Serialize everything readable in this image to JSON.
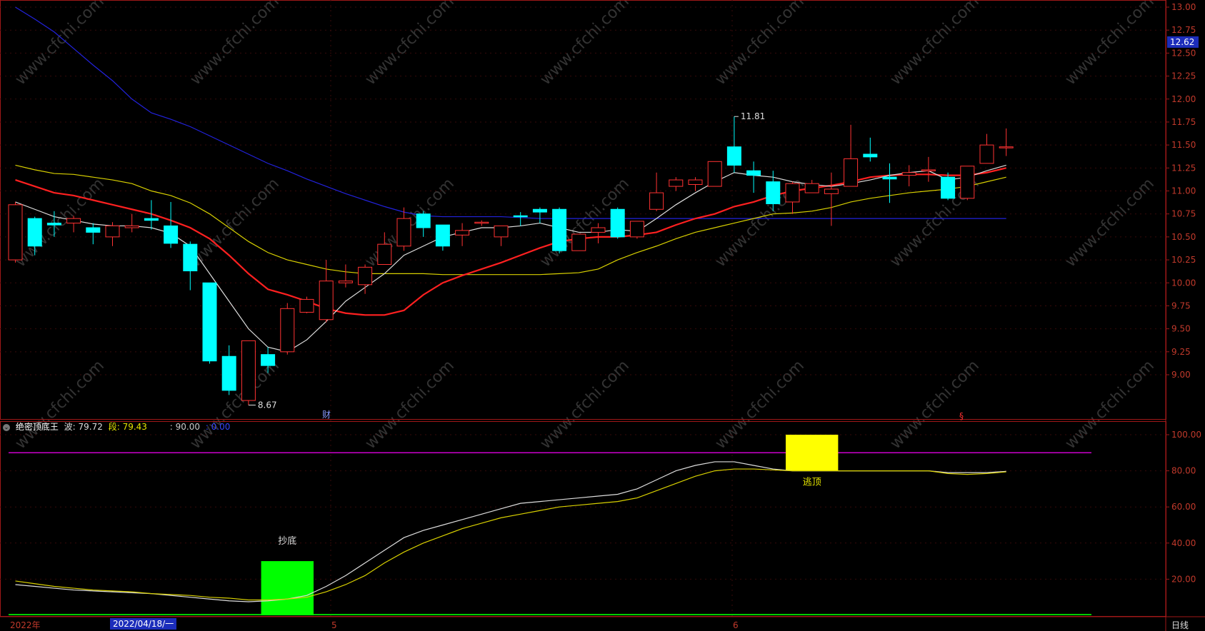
{
  "chart_data": [
    {
      "type": "candlestick",
      "ylim": [
        8.5,
        13.0
      ],
      "y_ticks": [
        "13.00",
        "12.75",
        "12.50",
        "12.25",
        "12.00",
        "11.75",
        "11.50",
        "11.25",
        "11.00",
        "10.75",
        "10.50",
        "10.25",
        "10.00",
        "9.75",
        "9.50",
        "9.25",
        "9.00"
      ],
      "current_price": "12.62",
      "annotations": {
        "high": "11.81",
        "low": "8.67",
        "cai_marker": "财",
        "s_marker": "§"
      },
      "candles": [
        [
          10.25,
          10.85,
          10.22,
          10.88
        ],
        [
          10.7,
          10.4,
          10.3,
          10.72
        ],
        [
          10.65,
          10.63,
          10.5,
          10.78
        ],
        [
          10.65,
          10.7,
          10.55,
          10.73
        ],
        [
          10.6,
          10.55,
          10.42,
          10.65
        ],
        [
          10.5,
          10.62,
          10.4,
          10.66
        ],
        [
          10.6,
          10.62,
          10.55,
          10.75
        ],
        [
          10.7,
          10.68,
          10.58,
          10.9
        ],
        [
          10.62,
          10.43,
          10.38,
          10.88
        ],
        [
          10.42,
          10.13,
          9.92,
          10.45
        ],
        [
          10.0,
          9.15,
          9.12,
          10.0
        ],
        [
          9.2,
          8.83,
          8.78,
          9.32
        ],
        [
          8.72,
          9.37,
          8.67,
          9.37
        ],
        [
          9.22,
          9.1,
          9.02,
          9.3
        ],
        [
          9.25,
          9.72,
          9.22,
          9.78
        ],
        [
          9.68,
          9.82,
          9.67,
          9.85
        ],
        [
          9.6,
          10.02,
          9.57,
          10.25
        ],
        [
          10.0,
          10.02,
          9.95,
          10.2
        ],
        [
          9.98,
          10.17,
          9.88,
          10.2
        ],
        [
          10.2,
          10.42,
          10.2,
          10.55
        ],
        [
          10.4,
          10.7,
          10.35,
          10.82
        ],
        [
          10.75,
          10.6,
          10.5,
          10.78
        ],
        [
          10.63,
          10.4,
          10.35,
          10.63
        ],
        [
          10.52,
          10.57,
          10.4,
          10.65
        ],
        [
          10.65,
          10.66,
          10.62,
          10.68
        ],
        [
          10.5,
          10.62,
          10.4,
          10.62
        ],
        [
          10.73,
          10.72,
          10.62,
          10.77
        ],
        [
          10.8,
          10.77,
          10.65,
          10.82
        ],
        [
          10.8,
          10.35,
          10.32,
          10.82
        ],
        [
          10.35,
          10.53,
          10.35,
          10.53
        ],
        [
          10.55,
          10.6,
          10.43,
          10.65
        ],
        [
          10.8,
          10.5,
          10.48,
          10.82
        ],
        [
          10.5,
          10.67,
          10.48,
          10.67
        ],
        [
          10.8,
          10.98,
          10.78,
          11.2
        ],
        [
          11.05,
          11.12,
          11.0,
          11.15
        ],
        [
          11.07,
          11.12,
          11.0,
          11.15
        ],
        [
          11.05,
          11.32,
          11.05,
          11.32
        ],
        [
          11.48,
          11.28,
          11.2,
          11.81
        ],
        [
          11.22,
          11.17,
          10.98,
          11.32
        ],
        [
          11.1,
          10.86,
          10.78,
          11.22
        ],
        [
          10.88,
          11.08,
          10.75,
          11.1
        ],
        [
          10.98,
          11.08,
          10.98,
          11.12
        ],
        [
          10.97,
          11.02,
          10.62,
          11.2
        ],
        [
          11.05,
          11.35,
          11.05,
          11.72
        ],
        [
          11.4,
          11.37,
          11.32,
          11.58
        ],
        [
          11.15,
          11.13,
          10.87,
          11.3
        ],
        [
          11.17,
          11.2,
          11.05,
          11.28
        ],
        [
          11.22,
          11.23,
          11.1,
          11.37
        ],
        [
          11.15,
          10.92,
          10.9,
          11.2
        ],
        [
          10.92,
          11.27,
          10.9,
          11.27
        ],
        [
          11.3,
          11.5,
          11.3,
          11.62
        ],
        [
          11.48,
          11.48,
          11.38,
          11.68
        ]
      ],
      "ma_white": [
        10.88,
        10.8,
        10.72,
        10.68,
        10.64,
        10.62,
        10.62,
        10.6,
        10.54,
        10.4,
        10.1,
        9.8,
        9.5,
        9.3,
        9.25,
        9.38,
        9.58,
        9.8,
        9.95,
        10.1,
        10.3,
        10.4,
        10.5,
        10.55,
        10.6,
        10.6,
        10.62,
        10.65,
        10.6,
        10.55,
        10.55,
        10.58,
        10.56,
        10.7,
        10.85,
        10.98,
        11.1,
        11.2,
        11.17,
        11.15,
        11.1,
        11.07,
        11.05,
        11.08,
        11.12,
        11.17,
        11.2,
        11.22,
        11.12,
        11.15,
        11.22,
        11.28
      ],
      "ma_red": [
        11.12,
        11.05,
        10.98,
        10.95,
        10.9,
        10.85,
        10.8,
        10.75,
        10.68,
        10.6,
        10.48,
        10.3,
        10.1,
        9.93,
        9.87,
        9.8,
        9.72,
        9.67,
        9.65,
        9.65,
        9.7,
        9.87,
        10.0,
        10.08,
        10.15,
        10.22,
        10.3,
        10.38,
        10.45,
        10.48,
        10.5,
        10.5,
        10.52,
        10.55,
        10.63,
        10.7,
        10.75,
        10.83,
        10.88,
        10.95,
        11.0,
        11.03,
        11.06,
        11.1,
        11.15,
        11.17,
        11.18,
        11.18,
        11.17,
        11.17,
        11.2,
        11.25
      ],
      "ma_yellow": [
        11.28,
        11.23,
        11.19,
        11.18,
        11.15,
        11.12,
        11.08,
        11.0,
        10.95,
        10.87,
        10.75,
        10.6,
        10.45,
        10.33,
        10.25,
        10.2,
        10.15,
        10.12,
        10.1,
        10.1,
        10.1,
        10.1,
        10.09,
        10.09,
        10.09,
        10.09,
        10.09,
        10.09,
        10.1,
        10.11,
        10.15,
        10.25,
        10.33,
        10.4,
        10.48,
        10.55,
        10.6,
        10.65,
        10.7,
        10.75,
        10.76,
        10.78,
        10.82,
        10.88,
        10.92,
        10.95,
        10.98,
        11.0,
        11.02,
        11.05,
        11.1,
        11.15
      ],
      "ma_blue": [
        13.0,
        12.87,
        12.73,
        12.55,
        12.37,
        12.2,
        12.0,
        11.85,
        11.78,
        11.7,
        11.6,
        11.5,
        11.4,
        11.3,
        11.22,
        11.13,
        11.05,
        10.97,
        10.9,
        10.83,
        10.77,
        10.73,
        10.72,
        10.72,
        10.72,
        10.72,
        10.71,
        10.7,
        10.7,
        10.7,
        10.7,
        10.7,
        10.7,
        10.7,
        10.7,
        10.7,
        10.7,
        10.7,
        10.7,
        10.7,
        10.7,
        10.7,
        10.7,
        10.7,
        10.7,
        10.7,
        10.7,
        10.7,
        10.7,
        10.7,
        10.7,
        10.7
      ]
    },
    {
      "type": "line",
      "title": "绝密顶底王",
      "legend": {
        "wave_label": "波: 79.72",
        "segment_label": "段: 79.43",
        "level_label": ": 90.00",
        "zero_label": ": 0.00"
      },
      "ylim": [
        0,
        105
      ],
      "y_ticks": [
        "100.00",
        "80.00",
        "60.00",
        "40.00",
        "20.00"
      ],
      "threshold_high": 90,
      "threshold_low": 0,
      "signals": [
        {
          "label": "抄底",
          "type": "buy",
          "bar_start": 13,
          "bar_end": 15,
          "y_from": 0,
          "y_to": 30,
          "color": "#00ff00"
        },
        {
          "label": "逃顶",
          "type": "sell",
          "bar_start": 40,
          "bar_end": 42,
          "y_from": 80,
          "y_to": 100,
          "color": "#ffff00"
        }
      ],
      "series": [
        {
          "values": [
            17,
            16,
            15,
            14,
            13.5,
            13,
            12.5,
            12,
            11,
            10,
            9,
            8,
            7.5,
            8,
            9,
            11,
            16,
            22,
            29,
            36,
            43,
            47,
            50,
            53,
            56,
            59,
            62,
            63,
            64,
            65,
            66,
            67,
            70,
            75,
            80,
            83,
            85,
            85,
            83,
            81,
            80,
            80,
            80,
            80,
            80,
            80,
            80,
            80,
            79,
            79,
            79,
            79.72
          ]
        },
        {
          "values": [
            19,
            17.5,
            16,
            15,
            14,
            13.5,
            13,
            12,
            11.5,
            11,
            10,
            9.5,
            8.5,
            8.5,
            9,
            10,
            13,
            17,
            22,
            29,
            35,
            40,
            44,
            48,
            51,
            54,
            56,
            58,
            60,
            61,
            62,
            63,
            65,
            69,
            73,
            77,
            80,
            81,
            81,
            80.5,
            80,
            80,
            80,
            80,
            80,
            80,
            80,
            80,
            78.5,
            78,
            78.5,
            79.43
          ]
        }
      ]
    }
  ],
  "time_axis": {
    "year_label": "2022年",
    "cursor_date": "2022/04/18/一",
    "month_labels": [
      "5",
      "6"
    ],
    "period": "日线"
  },
  "colors": {
    "up": "#ff3232",
    "down": "#00ffff",
    "ma_white": "#dddddd",
    "ma_red": "#ff2020",
    "ma_yellow": "#d8d000",
    "ma_blue": "#2222dd",
    "axis": "#a01818",
    "threshold": "#cc00cc",
    "zero_line": "#00cc00"
  },
  "watermark": "www.cfchi.com"
}
